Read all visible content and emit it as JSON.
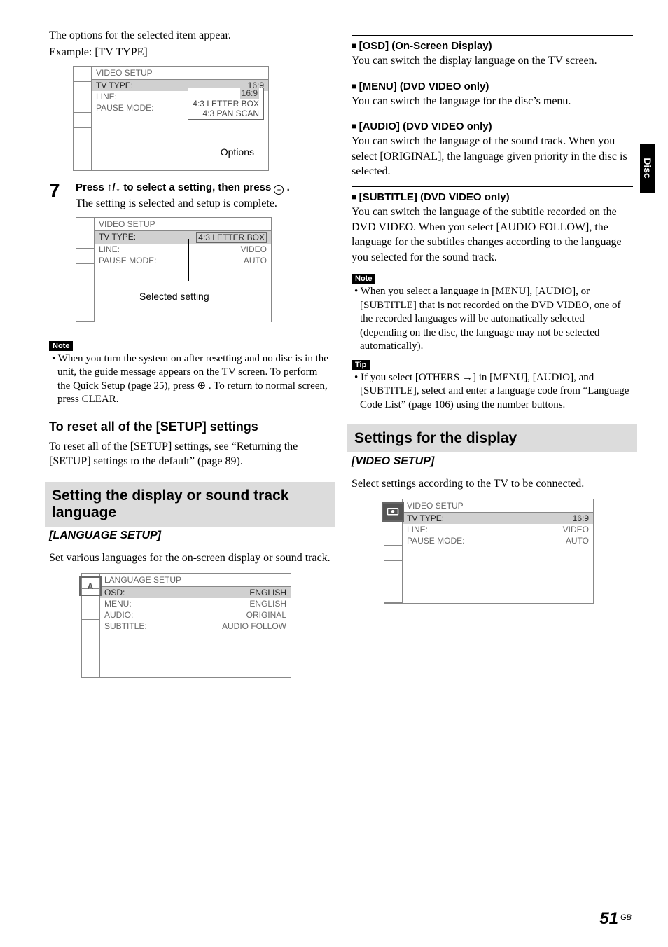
{
  "sideTab": "Disc",
  "pageNumber": "51",
  "pageNumberSuffix": "GB",
  "leftCol": {
    "intro1": "The options for the selected item appear.",
    "intro2": "Example: [TV TYPE]",
    "osd1": {
      "title": "VIDEO SETUP",
      "rows": [
        {
          "label": "TV TYPE:",
          "value": "16:9"
        },
        {
          "label": "LINE:",
          "value": "16:9"
        },
        {
          "label": "PAUSE MODE:",
          "value": "4:3 LETTER BOX"
        }
      ],
      "extraOption": "4:3 PAN SCAN",
      "callout": "Options"
    },
    "step7": {
      "num": "7",
      "headA": "Press ",
      "headArrows": "↑/↓",
      "headB": " to select a setting, then press ",
      "headC": " .",
      "desc": "The setting is selected and setup is complete."
    },
    "osd2": {
      "title": "VIDEO SETUP",
      "rows": [
        {
          "label": "TV TYPE:",
          "value": "4:3 LETTER BOX"
        },
        {
          "label": "LINE:",
          "value": "VIDEO"
        },
        {
          "label": "PAUSE MODE:",
          "value": "AUTO"
        }
      ],
      "callout": "Selected setting"
    },
    "noteLabel": "Note",
    "noteBullet": "When you turn the system on after resetting and no disc is in the unit, the guide message appears on the TV screen. To perform the Quick Setup (page 25), press ⊕ . To return to normal screen, press CLEAR.",
    "resetHead": "To reset all of the [SETUP] settings",
    "resetBody": "To reset all of the [SETUP] settings, see “Returning the [SETUP] settings to the default” (page 89).",
    "sectionBand": "Setting the display or sound track language",
    "sectionSub": "[LANGUAGE SETUP]",
    "langBody": "Set various languages for the on-screen display or sound track.",
    "osd3": {
      "iconLetter": "A",
      "title": "LANGUAGE SETUP",
      "rows": [
        {
          "label": "OSD:",
          "value": "ENGLISH"
        },
        {
          "label": "MENU:",
          "value": "ENGLISH"
        },
        {
          "label": "AUDIO:",
          "value": "ORIGINAL"
        },
        {
          "label": "SUBTITLE:",
          "value": "AUDIO FOLLOW"
        }
      ]
    }
  },
  "rightCol": {
    "osdSec": {
      "head": "[OSD] (On-Screen Display)",
      "body": "You can switch the display language on the TV screen."
    },
    "menuSec": {
      "head": "[MENU] (DVD VIDEO only)",
      "body": "You can switch the language for the disc’s menu."
    },
    "audioSec": {
      "head": "[AUDIO] (DVD VIDEO only)",
      "body": "You can switch the language of the sound track. When you select [ORIGINAL], the language given priority in the disc is selected."
    },
    "subtitleSec": {
      "head": "[SUBTITLE] (DVD VIDEO only)",
      "body": "You can switch the language of the subtitle recorded on the DVD VIDEO. When you select [AUDIO FOLLOW], the language for the subtitles changes according to the language you selected for the sound track."
    },
    "noteLabel": "Note",
    "noteBullet": "When you select a language in [MENU], [AUDIO], or [SUBTITLE] that is not recorded on the DVD VIDEO, one of the recorded languages will be automatically selected (depending on the disc, the language may not be selected automatically).",
    "tipLabel": "Tip",
    "tipBullet": "If you select [OTHERS →] in [MENU], [AUDIO], and [SUBTITLE], select and enter a language code from “Language Code List” (page 106) using the number buttons.",
    "sectionBand": "Settings for the display",
    "sectionSub": "[VIDEO SETUP]",
    "videoBody": "Select settings according to the TV to be connected.",
    "osd4": {
      "title": "VIDEO SETUP",
      "rows": [
        {
          "label": "TV TYPE:",
          "value": "16:9"
        },
        {
          "label": "LINE:",
          "value": "VIDEO"
        },
        {
          "label": "PAUSE MODE:",
          "value": "AUTO"
        }
      ]
    }
  }
}
